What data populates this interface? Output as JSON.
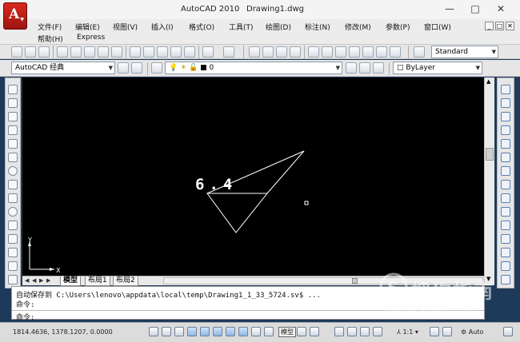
{
  "window": {
    "app_logo": "A",
    "app_name": "AutoCAD 2010",
    "doc_name": "Drawing1.dwg",
    "minimize": "—",
    "maximize": "□",
    "close": "✕"
  },
  "menu": {
    "items": [
      "文件(F)",
      "编辑(E)",
      "视图(V)",
      "插入(I)",
      "格式(O)",
      "工具(T)",
      "绘图(D)",
      "标注(N)",
      "修改(M)",
      "参数(P)",
      "窗口(W)"
    ],
    "items_row2": [
      "帮助(H)",
      "Express"
    ],
    "doc_controls": [
      "_",
      "□",
      "✕"
    ]
  },
  "toolbar": {
    "text_style": "Standard",
    "workspace": "AutoCAD 经典",
    "layer": "0",
    "color": "ByLayer"
  },
  "drawing": {
    "annotation": "6.4",
    "ucs_y": "Y",
    "ucs_x": "X",
    "background": "#000000",
    "stroke": "#ffffff"
  },
  "tabs": [
    {
      "label": "模型",
      "active": true
    },
    {
      "label": "布局1",
      "active": false
    },
    {
      "label": "布局2",
      "active": false
    }
  ],
  "command": {
    "line1": "自动保存到 C:\\Users\\lenovo\\appdata\\local\\temp\\Drawing1_1_33_5724.sv$ ...",
    "line2": "命令:",
    "prompt": "命令:"
  },
  "status": {
    "coordinates": "1814.4636, 1378.1207, 0.0000",
    "model_label": "模型",
    "scale": "1:1",
    "auto": "Auto"
  },
  "watermark": {
    "text": "搜狗指南",
    "url": "zhinan.sogou.com"
  },
  "icons": {
    "left": [
      "line-icon",
      "construction-line-icon",
      "polyline-icon",
      "polygon-icon",
      "rectangle-icon",
      "arc-icon",
      "circle-icon",
      "revision-cloud-icon",
      "spline-icon",
      "ellipse-icon",
      "ellipse-arc-icon",
      "insert-block-icon",
      "make-block-icon",
      "point-icon",
      "hatch-icon"
    ],
    "right": [
      "erase-icon",
      "copy-icon",
      "mirror-icon",
      "offset-icon",
      "array-icon",
      "move-icon",
      "rotate-icon",
      "scale-icon",
      "stretch-icon",
      "trim-icon",
      "extend-icon",
      "break-icon",
      "join-icon",
      "chamfer-icon",
      "fillet-icon"
    ]
  }
}
